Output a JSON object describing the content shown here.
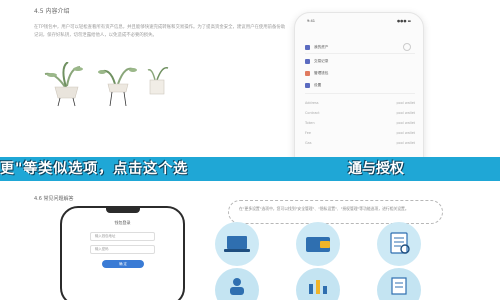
{
  "top": {
    "heading": "4.5 内容介绍",
    "paragraph": "在TP钱包中，用户可以轻松查看所有资产信息，并且能够快速完成转账和交易操作。为了提高资金安全，建议用户在使用前备份助记词，保存好私钥，切勿泄露给他人，以免造成不必要的损失。"
  },
  "phone_top": {
    "time": "9:41",
    "signal": "●●● ▬",
    "menu": [
      {
        "label": "我的资产",
        "color": "#5b6bc0"
      },
      {
        "label": "交易记录",
        "color": "#5b6bc0"
      },
      {
        "label": "管理钱包",
        "color": "#e07a5f"
      },
      {
        "label": "设置",
        "color": "#5b6bc0"
      }
    ],
    "list": [
      {
        "name": "Address",
        "value": "pool wallet"
      },
      {
        "name": "Contract",
        "value": "pool wallet"
      },
      {
        "name": "Token",
        "value": "pool wallet"
      },
      {
        "name": "Fee",
        "value": "pool wallet"
      },
      {
        "name": "Gas",
        "value": "pool wallet"
      }
    ]
  },
  "banner": {
    "text": "更\"等类似选项，点击这个选",
    "text_right": "通与授权"
  },
  "sub": {
    "heading": "4.6 常见问题解答"
  },
  "phone_bottom": {
    "title": "钱包登录",
    "field1": "输入钱包地址",
    "field2": "输入密码",
    "button": "确 定"
  },
  "bubble": {
    "text": "在\"更多设置\"选项中，您可以找到\"安全管理\"、\"隐私设置\"、\"授权管理\"等功能选项，进行相关设置。"
  },
  "colors": {
    "banner_bg": "#1fa7d6",
    "circle_bg": "#cde9f5",
    "accent": "#3a7bd5"
  }
}
